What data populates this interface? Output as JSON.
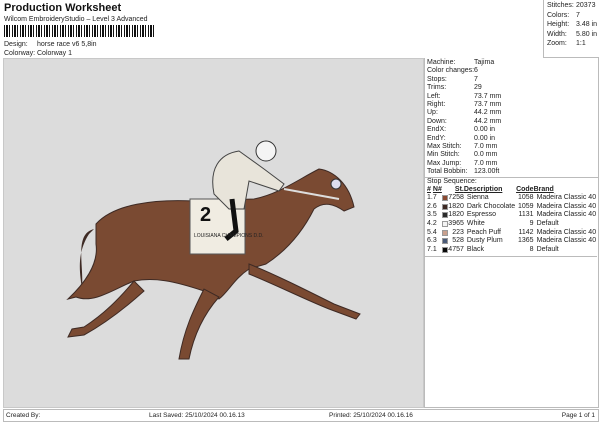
{
  "header": {
    "title": "Production Worksheet",
    "subtitle": "Wilcom EmbroideryStudio – Level 3 Advanced",
    "design_label": "Design:",
    "design": "horse race v6 5,8in",
    "colorway_label": "Colorway:",
    "colorway": "Colorway 1"
  },
  "stats": [
    {
      "k": "Stitches:",
      "v": "20373"
    },
    {
      "k": "Colors:",
      "v": "7"
    },
    {
      "k": "Height:",
      "v": "3.48 in"
    },
    {
      "k": "Width:",
      "v": "5.80 in"
    },
    {
      "k": "Zoom:",
      "v": "1:1"
    }
  ],
  "props": [
    {
      "k": "Machine:",
      "v": "Tajima"
    },
    {
      "k": "Color changes:",
      "v": "6"
    },
    {
      "k": "Stops:",
      "v": "7"
    },
    {
      "k": "Trims:",
      "v": "29"
    },
    {
      "k": "Left:",
      "v": "73.7 mm"
    },
    {
      "k": "Right:",
      "v": "73.7 mm"
    },
    {
      "k": "Up:",
      "v": "44.2 mm"
    },
    {
      "k": "Down:",
      "v": "44.2 mm"
    },
    {
      "k": "EndX:",
      "v": "0.00 in"
    },
    {
      "k": "EndY:",
      "v": "0.00 in"
    },
    {
      "k": "Max Stitch:",
      "v": "7.0 mm"
    },
    {
      "k": "Min Stitch:",
      "v": "0.0 mm"
    },
    {
      "k": "Max Jump:",
      "v": "7.0 mm"
    },
    {
      "k": "Total Bobbin:",
      "v": "123.00ft"
    }
  ],
  "stop_sequence": {
    "label": "Stop Sequence:",
    "headers": [
      "#",
      "N#",
      "St.",
      "Description",
      "Code",
      "Brand"
    ],
    "rows": [
      {
        "n": "1.",
        "c": "7",
        "color": "#8a4a32",
        "st": "7258",
        "desc": "Sienna",
        "code": "1058",
        "brand": "Madeira Classic 40"
      },
      {
        "n": "2.",
        "c": "6",
        "color": "#3e2a24",
        "st": "1820",
        "desc": "Dark Chocolate",
        "code": "1059",
        "brand": "Madeira Classic 40"
      },
      {
        "n": "3.",
        "c": "5",
        "color": "#2a2a2a",
        "st": "1820",
        "desc": "Espresso",
        "code": "1131",
        "brand": "Madeira Classic 40"
      },
      {
        "n": "4.",
        "c": "2",
        "color": "#f4f4f4",
        "st": "3965",
        "desc": "White",
        "code": "9",
        "brand": "Default"
      },
      {
        "n": "5.",
        "c": "4",
        "color": "#c9a08e",
        "st": "223",
        "desc": "Peach Puff",
        "code": "1142",
        "brand": "Madeira Classic 40"
      },
      {
        "n": "6.",
        "c": "3",
        "color": "#4a5a78",
        "st": "528",
        "desc": "Dusty Plum",
        "code": "1365",
        "brand": "Madeira Classic 40"
      },
      {
        "n": "7.",
        "c": "1",
        "color": "#0a0a0a",
        "st": "4757",
        "desc": "Black",
        "code": "8",
        "brand": "Default"
      }
    ]
  },
  "design_art": {
    "saddle_number": "2",
    "saddle_text": "LOUISIANA CHAMPIONS D.D."
  },
  "footer": {
    "created": "Created By:",
    "saved": "Last Saved: 25/10/2024 00.16.13",
    "printed": "Printed: 25/10/2024 00.16.16",
    "page": "Page 1 of 1"
  }
}
